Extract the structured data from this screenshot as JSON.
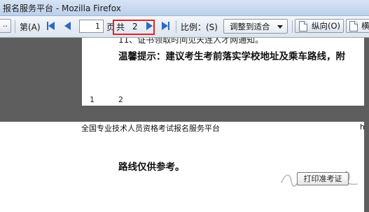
{
  "window": {
    "title": "报名服务平台 - Mozilla Firefox"
  },
  "toolbar": {
    "first_chunk": "..",
    "page_prefix": "第(A)",
    "page_value": "1",
    "page_unit": "页",
    "total_label": "共",
    "total_pages": "2",
    "scale_label": "比例：(S)",
    "scale_value": "调整到适合",
    "portrait_label": "纵向(O)",
    "landscape_label": "横"
  },
  "page1": {
    "line_top": "11、证书领取时间见天连人才网通知。",
    "tip": "温馨提示：建议考生考前落实学校地址及乘车路线，附",
    "footer_left": "1",
    "footer_right": "2"
  },
  "page2": {
    "header_left": "全国专业技术人员资格考试报名服务平台",
    "header_right": "h",
    "body": "路线仅供参考。",
    "print_button": "打印准考证"
  },
  "colors": {
    "highlight": "#e02424",
    "nav_arrow": "#2d68c4"
  }
}
